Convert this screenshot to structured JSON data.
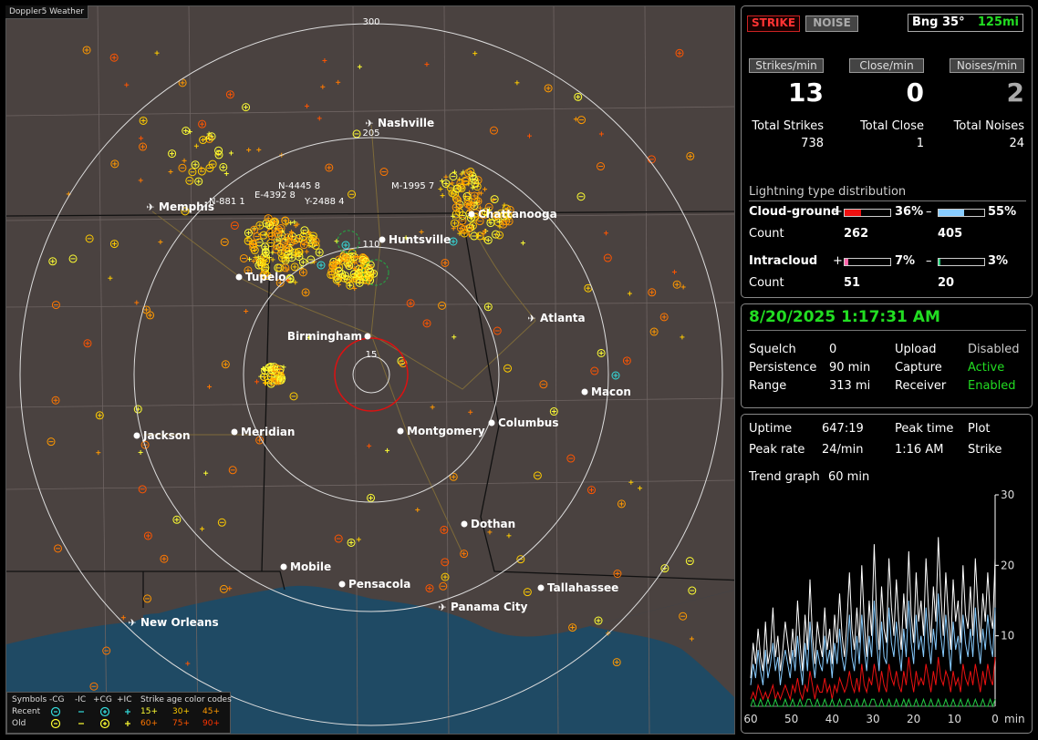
{
  "app_title": "Doppler5 Weather",
  "map": {
    "ring_labels": [
      "300",
      "205",
      "110",
      "15"
    ],
    "cities": [
      {
        "name": "Nashville",
        "airport": true
      },
      {
        "name": "Memphis",
        "airport": true
      },
      {
        "name": "Chattanooga",
        "airport": false
      },
      {
        "name": "Huntsville",
        "airport": false
      },
      {
        "name": "Tupelo",
        "airport": false
      },
      {
        "name": "Atlanta",
        "airport": true
      },
      {
        "name": "Birmingham",
        "airport": false
      },
      {
        "name": "Macon",
        "airport": false
      },
      {
        "name": "Jackson",
        "airport": false
      },
      {
        "name": "Meridian",
        "airport": false
      },
      {
        "name": "Montgomery",
        "airport": false
      },
      {
        "name": "Columbus",
        "airport": false
      },
      {
        "name": "Dothan",
        "airport": false
      },
      {
        "name": "Mobile",
        "airport": false
      },
      {
        "name": "Pensacola",
        "airport": false
      },
      {
        "name": "Tallahassee",
        "airport": false
      },
      {
        "name": "Panama City",
        "airport": true
      },
      {
        "name": "New Orleans",
        "airport": true
      }
    ],
    "storm_labels": [
      "N-4445 8",
      "E-4392 8",
      "N-881 1",
      "Y-2488 4",
      "M-1995 7"
    ]
  },
  "legend": {
    "symbols_label": "Symbols",
    "col_labels": [
      "-CG",
      "-IC",
      "+CG",
      "+IC"
    ],
    "age_title": "Strike age color codes",
    "recent_label": "Recent",
    "old_label": "Old",
    "recent_ages": [
      "15+",
      "30+",
      "45+"
    ],
    "old_ages": [
      "60+",
      "75+",
      "90+"
    ],
    "recent_age_colors": [
      "#ffff33",
      "#ffcc00",
      "#ff9900"
    ],
    "old_age_colors": [
      "#ff7700",
      "#ff5500",
      "#ff3300"
    ]
  },
  "top": {
    "strike_btn": "STRIKE",
    "noise_btn": "NOISE",
    "bearing": "Bng 35°",
    "range": "125mi",
    "strikes_min_label": "Strikes/min",
    "close_min_label": "Close/min",
    "noises_min_label": "Noises/min",
    "strikes_min": "13",
    "close_min": "0",
    "noises_min": "2",
    "total_strikes_label": "Total Strikes",
    "total_close_label": "Total Close",
    "total_noises_label": "Total Noises",
    "total_strikes": "738",
    "total_close": "1",
    "total_noises": "24"
  },
  "distribution": {
    "title": "Lightning type distribution",
    "cg_label": "Cloud-ground",
    "ic_label": "Intracloud",
    "count_label": "Count",
    "plus": "+",
    "minus": "–",
    "cg_pos_pct": "36%",
    "cg_neg_pct": "55%",
    "cg_pos_count": "262",
    "cg_neg_count": "405",
    "ic_pos_pct": "7%",
    "ic_neg_pct": "3%",
    "ic_pos_count": "51",
    "ic_neg_count": "20",
    "fill": {
      "cg_pos": 0.36,
      "cg_neg": 0.55,
      "ic_pos": 0.07,
      "ic_neg": 0.03
    },
    "colors": {
      "cg_pos": "#ee1111",
      "cg_neg": "#88ccff",
      "ic_pos": "#ff66aa",
      "ic_neg": "#22cc77"
    }
  },
  "status": {
    "datetime": "8/20/2025 1:17:31 AM",
    "squelch_label": "Squelch",
    "squelch": "0",
    "persistence_label": "Persistence",
    "persistence": "90 min",
    "range_label": "Range",
    "range": "313 mi",
    "upload_label": "Upload",
    "upload": "Disabled",
    "capture_label": "Capture",
    "capture": "Active",
    "receiver_label": "Receiver",
    "receiver": "Enabled"
  },
  "stats": {
    "uptime_label": "Uptime",
    "uptime": "647:19",
    "peak_time_label": "Peak time",
    "peak_time": "1:16 AM",
    "plot_label": "Plot",
    "plot": "Strike",
    "peak_rate_label": "Peak rate",
    "peak_rate": "24/min",
    "trend_label": "Trend graph",
    "trend": "60 min"
  },
  "chart_data": {
    "type": "line",
    "x_label": "min",
    "x_ticks": [
      60,
      50,
      40,
      30,
      20,
      10,
      0
    ],
    "y_ticks": [
      10,
      20,
      30
    ],
    "xlim": [
      60,
      0
    ],
    "ylim": [
      0,
      30
    ],
    "series": [
      {
        "color": "#ffffff",
        "values": [
          4,
          9,
          6,
          11,
          7,
          5,
          12,
          6,
          8,
          14,
          7,
          10,
          5,
          8,
          12,
          9,
          6,
          11,
          7,
          15,
          9,
          5,
          13,
          8,
          18,
          10,
          6,
          12,
          9,
          7,
          14,
          8,
          11,
          6,
          13,
          9,
          16,
          10,
          7,
          12,
          19,
          11,
          8,
          14,
          9,
          20,
          12,
          7,
          15,
          10,
          23,
          13,
          8,
          17,
          11,
          9,
          21,
          14,
          10,
          18,
          12,
          8,
          16,
          11,
          22,
          13,
          9,
          19,
          12,
          15,
          10,
          21,
          14,
          9,
          17,
          12,
          24,
          16,
          10,
          19,
          13,
          8,
          18,
          12,
          15,
          9,
          20,
          13,
          11,
          17,
          10,
          21,
          14,
          9,
          16,
          12,
          19,
          13,
          11,
          21
        ]
      },
      {
        "color": "#88ccff",
        "values": [
          3,
          6,
          4,
          8,
          5,
          3,
          8,
          4,
          6,
          9,
          5,
          7,
          3,
          6,
          8,
          6,
          4,
          8,
          5,
          10,
          6,
          3,
          9,
          5,
          12,
          7,
          4,
          8,
          6,
          5,
          10,
          6,
          8,
          4,
          9,
          6,
          11,
          7,
          5,
          8,
          13,
          7,
          5,
          10,
          6,
          13,
          8,
          5,
          10,
          7,
          15,
          9,
          5,
          12,
          7,
          6,
          14,
          9,
          7,
          12,
          8,
          5,
          11,
          7,
          15,
          9,
          6,
          13,
          8,
          10,
          7,
          14,
          9,
          6,
          11,
          8,
          16,
          10,
          7,
          13,
          9,
          5,
          12,
          8,
          10,
          6,
          13,
          9,
          7,
          11,
          7,
          14,
          9,
          6,
          11,
          8,
          13,
          9,
          7,
          14
        ]
      },
      {
        "color": "#ee1111",
        "values": [
          1,
          2,
          1,
          3,
          2,
          1,
          2,
          1,
          2,
          3,
          1,
          2,
          1,
          2,
          3,
          2,
          1,
          3,
          2,
          4,
          2,
          1,
          3,
          2,
          5,
          3,
          1,
          3,
          2,
          2,
          4,
          2,
          3,
          1,
          3,
          2,
          4,
          3,
          2,
          3,
          5,
          3,
          2,
          4,
          2,
          6,
          3,
          2,
          4,
          3,
          6,
          4,
          2,
          5,
          3,
          2,
          6,
          4,
          3,
          5,
          3,
          2,
          5,
          3,
          7,
          4,
          2,
          5,
          3,
          4,
          3,
          6,
          4,
          2,
          5,
          3,
          7,
          4,
          3,
          5,
          4,
          2,
          5,
          3,
          4,
          2,
          6,
          4,
          3,
          5,
          3,
          6,
          4,
          2,
          5,
          3,
          6,
          4,
          3,
          7
        ]
      },
      {
        "color": "#22cc44",
        "values": [
          0,
          1,
          0,
          0,
          1,
          0,
          0,
          1,
          0,
          0,
          1,
          0,
          0,
          0,
          1,
          0,
          0,
          1,
          0,
          0,
          1,
          0,
          0,
          1,
          1,
          0,
          0,
          1,
          0,
          0,
          1,
          0,
          0,
          1,
          0,
          0,
          1,
          0,
          0,
          1,
          1,
          0,
          0,
          1,
          0,
          0,
          1,
          0,
          0,
          1,
          1,
          0,
          0,
          1,
          0,
          0,
          1,
          0,
          0,
          1,
          0,
          0,
          1,
          0,
          1,
          0,
          0,
          1,
          0,
          0,
          1,
          0,
          0,
          1,
          0,
          0,
          1,
          0,
          0,
          1,
          0,
          0,
          1,
          0,
          0,
          1,
          0,
          0,
          1,
          0,
          0,
          1,
          0,
          0,
          1,
          0,
          0,
          1,
          0,
          1
        ]
      }
    ]
  }
}
